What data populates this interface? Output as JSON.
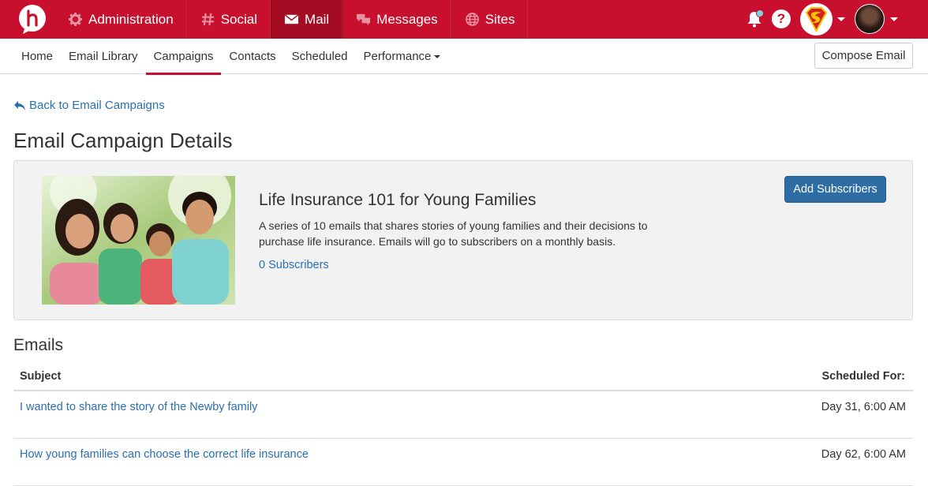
{
  "topnav": {
    "items": [
      {
        "label": "Administration",
        "icon": "gear-icon"
      },
      {
        "label": "Social",
        "icon": "hashtag-icon"
      },
      {
        "label": "Mail",
        "icon": "envelope-icon"
      },
      {
        "label": "Messages",
        "icon": "chat-bubbles-icon"
      },
      {
        "label": "Sites",
        "icon": "globe-icon"
      }
    ],
    "help_label": "?"
  },
  "subnav": {
    "tabs": [
      "Home",
      "Email Library",
      "Campaigns",
      "Contacts",
      "Scheduled",
      "Performance"
    ],
    "compose_label": "Compose Email"
  },
  "back_label": "Back to Email Campaigns",
  "page_title": "Email Campaign Details",
  "campaign": {
    "title": "Life Insurance 101 for Young Families",
    "description": "A series of 10 emails that shares stories of young families and their decisions to purchase life insurance. Emails will go to subscribers on a monthly basis.",
    "subscribers": "0 Subscribers",
    "add_button": "Add Subscribers"
  },
  "emails": {
    "title": "Emails",
    "columns": [
      "Subject",
      "Scheduled For:"
    ],
    "rows": [
      {
        "subject": "I wanted to share the story of the Newby family",
        "scheduled": "Day 31, 6:00 AM"
      },
      {
        "subject": "How young families can choose the correct life insurance",
        "scheduled": "Day 62, 6:00 AM"
      }
    ]
  },
  "colors": {
    "brand": "#c8102e",
    "link": "#2a6fb0",
    "primary_button": "#2e6da4"
  }
}
